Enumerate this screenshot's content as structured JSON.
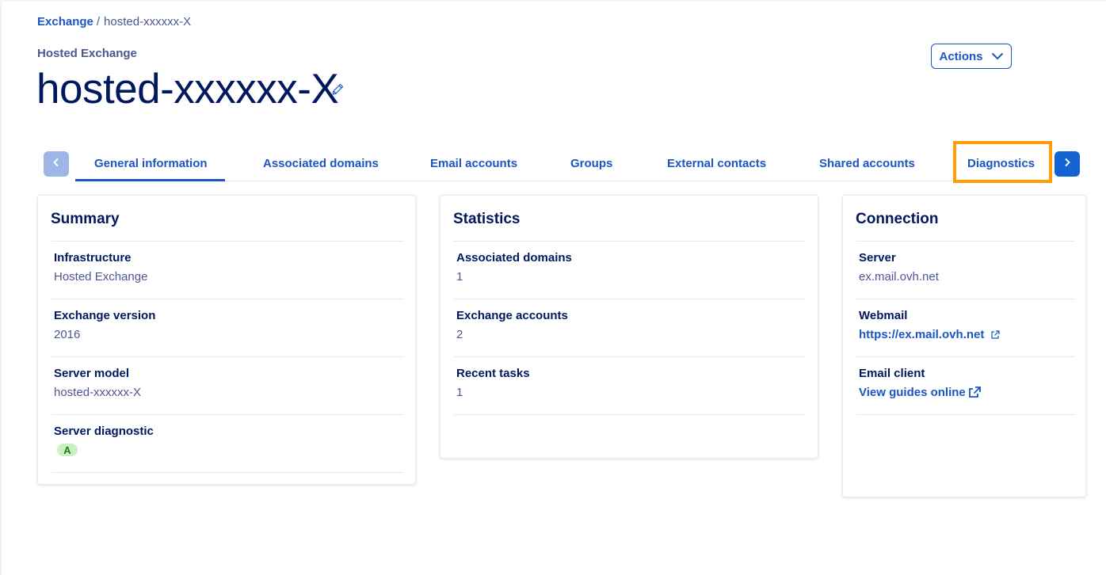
{
  "breadcrumb": {
    "root": "Exchange",
    "separator": "/",
    "current": "hosted-xxxxxx-X"
  },
  "header": {
    "subtitle": "Hosted Exchange",
    "title": "hosted-xxxxxx-X",
    "actions_label": "Actions"
  },
  "tabs": [
    {
      "label": "General information",
      "active": true
    },
    {
      "label": "Associated domains",
      "active": false
    },
    {
      "label": "Email accounts",
      "active": false
    },
    {
      "label": "Groups",
      "active": false
    },
    {
      "label": "External contacts",
      "active": false
    },
    {
      "label": "Shared accounts",
      "active": false
    },
    {
      "label": "Diagnostics",
      "active": false,
      "highlighted": true
    }
  ],
  "summary": {
    "title": "Summary",
    "items": [
      {
        "label": "Infrastructure",
        "value": "Hosted Exchange"
      },
      {
        "label": "Exchange version",
        "value": "2016"
      },
      {
        "label": "Server model",
        "value": "hosted-xxxxxx-X"
      },
      {
        "label": "Server diagnostic",
        "badge": "A"
      }
    ]
  },
  "statistics": {
    "title": "Statistics",
    "items": [
      {
        "label": "Associated domains",
        "value": "1"
      },
      {
        "label": "Exchange accounts",
        "value": "2"
      },
      {
        "label": "Recent tasks",
        "value": "1"
      }
    ]
  },
  "connection": {
    "title": "Connection",
    "items": [
      {
        "label": "Server",
        "value": "ex.mail.ovh.net"
      },
      {
        "label": "Webmail",
        "link": "https://ex.mail.ovh.net"
      },
      {
        "label": "Email client",
        "link": "View guides online"
      }
    ]
  },
  "colors": {
    "primary": "#1a56c4",
    "title": "#00185e",
    "muted": "#4d5693",
    "highlight": "#ff9c07",
    "badge_bg": "#c9f2c0"
  },
  "icons": {
    "edit": "pencil-icon",
    "actions": "chevron-down-icon",
    "tabs_prev": "chevron-left-icon",
    "tabs_next": "chevron-right-icon",
    "external": "external-link-icon"
  }
}
